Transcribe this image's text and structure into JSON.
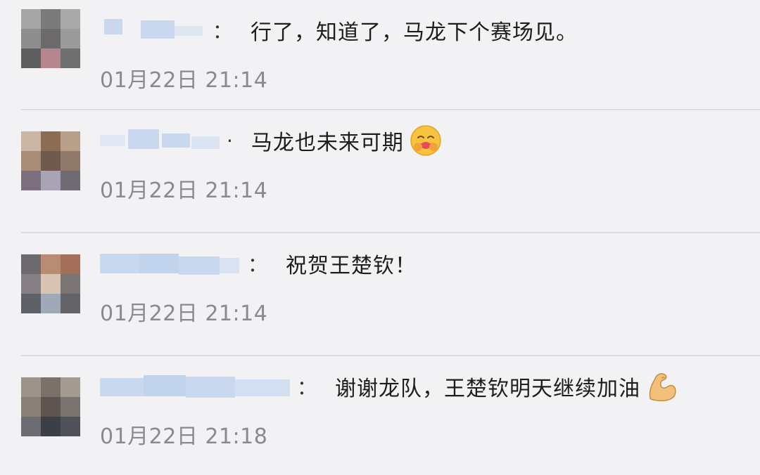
{
  "comments": [
    {
      "text": "行了，知道了，马龙下个赛场见。",
      "time": "01月22日 21:14",
      "colon": "：",
      "avatar": "blurred-user-avatar"
    },
    {
      "text": "马龙也未来可期",
      "time": "01月22日 21:14",
      "colon": "·",
      "emoji": "hugging-face-emoji",
      "avatar": "blurred-user-avatar"
    },
    {
      "text": "祝贺王楚钦！",
      "time": "01月22日 21:14",
      "colon": "：",
      "avatar": "blurred-user-avatar"
    },
    {
      "text": "谢谢龙队，王楚钦明天继续加油",
      "time": "01月22日 21:18",
      "colon": "：",
      "emoji": "flexed-biceps-emoji",
      "avatar": "blurred-user-avatar"
    }
  ],
  "colors": {
    "background": "#f2f2f4",
    "nickname_blur": "#c9d8ee",
    "text": "#1d1d1d",
    "timestamp": "#8a8a8e",
    "divider": "#dcdce0"
  }
}
